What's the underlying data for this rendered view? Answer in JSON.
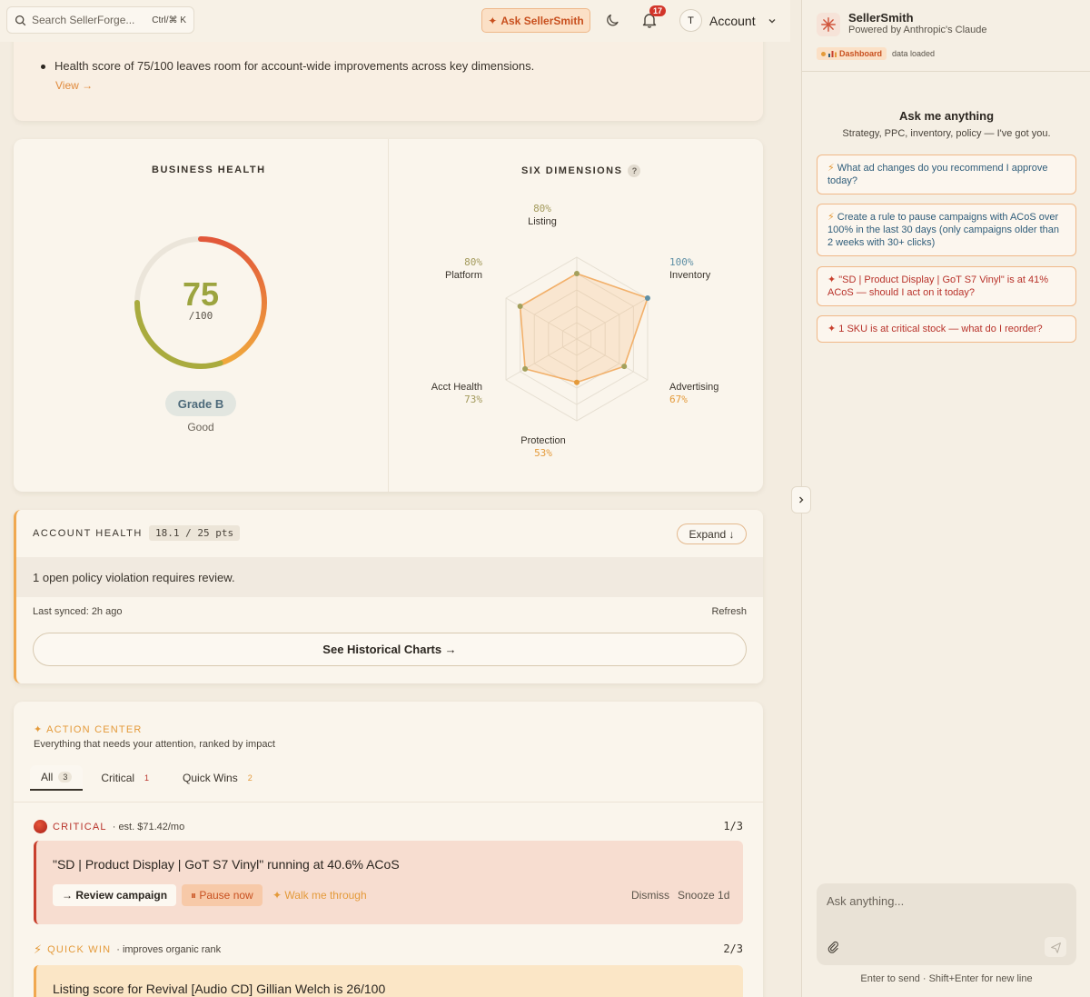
{
  "topbar": {
    "search_placeholder": "Search SellerForge...",
    "search_shortcut": "Ctrl/⌘ K",
    "ask_button": "Ask SellerSmith",
    "notifications_count": "17",
    "account_initial": "T",
    "account_label": "Account"
  },
  "summary": {
    "bullet": "Health score of 75/100 leaves room for account-wide improvements across key dimensions.",
    "view_link": "View →"
  },
  "business_health": {
    "title": "BUSINESS HEALTH",
    "score": "75",
    "score_max": "/100",
    "score_value": 75,
    "grade": "Grade B",
    "grade_desc": "Good"
  },
  "six_dimensions": {
    "title": "SIX DIMENSIONS",
    "help": "?",
    "dims": [
      {
        "name": "Listing",
        "pct": "80%",
        "value": 80
      },
      {
        "name": "Inventory",
        "pct": "100%",
        "value": 100
      },
      {
        "name": "Advertising",
        "pct": "67%",
        "value": 67
      },
      {
        "name": "Protection",
        "pct": "53%",
        "value": 53
      },
      {
        "name": "Acct Health",
        "pct": "73%",
        "value": 73
      },
      {
        "name": "Platform",
        "pct": "80%",
        "value": 80
      }
    ]
  },
  "account_health": {
    "title": "ACCOUNT HEALTH",
    "pts": "18.1 / 25 pts",
    "expand": "Expand ↓",
    "violation": "1 open policy violation requires review.",
    "synced": "Last synced: 2h ago",
    "refresh": "Refresh",
    "historical": "See Historical Charts →"
  },
  "action_center": {
    "title": "✦ ACTION CENTER",
    "subtitle": "Everything that needs your attention, ranked by impact",
    "tabs": [
      {
        "label": "All",
        "count": "3"
      },
      {
        "label": "Critical",
        "count": "1"
      },
      {
        "label": "Quick Wins",
        "count": "2"
      }
    ],
    "critical": {
      "label": "CRITICAL",
      "meta": "· est. $71.42/mo",
      "position": "1/3",
      "text": "\"SD | Product Display | GoT S7 Vinyl\" running at 40.6% ACoS",
      "review": "→ Review campaign",
      "pause": "⏸ Pause now",
      "walk": "✦ Walk me through",
      "dismiss": "Dismiss",
      "snooze": "Snooze 1d"
    },
    "quick_win": {
      "label": "QUICK WIN",
      "meta": "· improves organic rank",
      "position": "2/3",
      "text": "Listing score for Revival [Audio CD] Gillian Welch is 26/100"
    }
  },
  "assistant": {
    "name": "SellerSmith",
    "powered": "Powered by Anthropic's Claude",
    "context_chip": "Dashboard",
    "context_status": "data loaded",
    "heading": "Ask me anything",
    "subheading": "Strategy, PPC, inventory, policy — I've got you.",
    "suggestions": [
      {
        "icon": "⚡",
        "text": "What ad changes do you recommend I approve today?"
      },
      {
        "icon": "⚡",
        "text": "Create a rule to pause campaigns with ACoS over 100% in the last 30 days (only campaigns older than 2 weeks with 30+ clicks)"
      },
      {
        "icon": "✦",
        "text": "\"SD | Product Display | GoT S7 Vinyl\" is at 41% ACoS — should I act on it today?"
      },
      {
        "icon": "✦",
        "text": "1 SKU is at critical stock — what do I reorder?"
      }
    ],
    "input_placeholder": "Ask anything...",
    "hint": "Enter to send · Shift+Enter for new line"
  },
  "colors": {
    "accent": "#e49a3a",
    "critical": "#c8402e",
    "score": "#9ca43f",
    "link_blue": "#2f5d7a"
  }
}
